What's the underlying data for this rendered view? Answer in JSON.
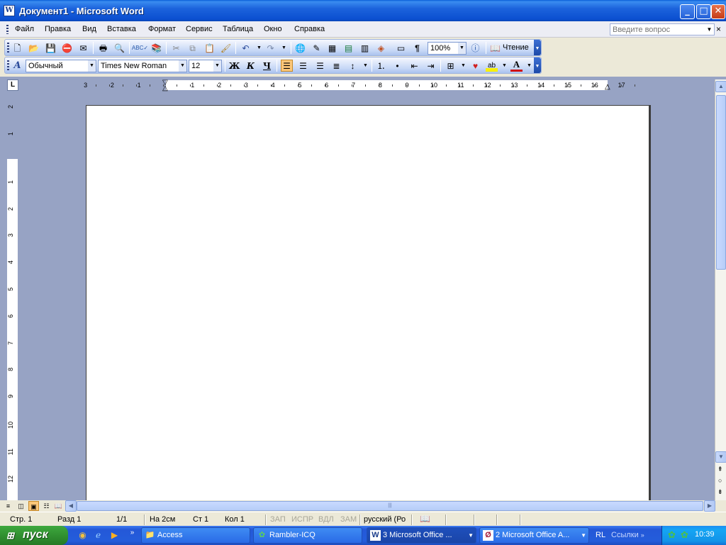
{
  "window": {
    "title": "Документ1 - Microsoft Word",
    "app_icon": "W",
    "controls": {
      "minimize": "_",
      "maximize": "□",
      "close": "✕"
    }
  },
  "menu": {
    "items": [
      "Файл",
      "Правка",
      "Вид",
      "Вставка",
      "Формат",
      "Сервис",
      "Таблица",
      "Окно",
      "Справка"
    ],
    "help_placeholder": "Введите вопрос",
    "doc_close": "×"
  },
  "toolbar_standard": {
    "icons": [
      "new-icon",
      "open-icon",
      "save-icon",
      "permission-icon",
      "email-icon",
      "print-icon",
      "print-preview-icon",
      "spelling-icon",
      "research-icon",
      "cut-icon",
      "copy-icon",
      "paste-icon",
      "format-painter-icon",
      "undo-icon",
      "redo-icon",
      "hyperlink-icon",
      "tables-borders-icon",
      "insert-table-icon",
      "insert-excel-icon",
      "columns-icon",
      "drawing-icon",
      "document-map-icon",
      "show-formatting-icon",
      "help-icon",
      "reading-icon"
    ],
    "zoom": "100%",
    "reading_label": "Чтение",
    "pilcrow": "¶"
  },
  "toolbar_formatting": {
    "style": "Обычный",
    "font": "Times New Roman",
    "size": "12",
    "bold": "Ж",
    "italic": "К",
    "underline": "Ч",
    "icons": [
      "styles-icon",
      "align-left-icon",
      "align-center-icon",
      "align-right-icon",
      "justify-icon",
      "line-spacing-icon",
      "numbering-icon",
      "bullets-icon",
      "decrease-indent-icon",
      "increase-indent-icon",
      "borders-icon",
      "heart-icon",
      "highlight-icon",
      "font-color-icon"
    ],
    "font_color_glyph": "A",
    "highlight_glyph": "ab"
  },
  "ruler": {
    "tab_selector": "L",
    "h_left_numbers": [
      "3",
      "2",
      "1"
    ],
    "h_right_numbers": [
      "1",
      "2",
      "3",
      "4",
      "5",
      "6",
      "7",
      "8",
      "9",
      "10",
      "11",
      "12",
      "13",
      "14",
      "15",
      "16",
      "17"
    ],
    "v_top_numbers": [
      "2",
      "1"
    ],
    "v_numbers": [
      "1",
      "2",
      "3",
      "4",
      "5",
      "6",
      "7",
      "8",
      "9",
      "10",
      "11",
      "12"
    ]
  },
  "status": {
    "page": "Стр. 1",
    "section": "Разд 1",
    "pages": "1/1",
    "at": "На 2см",
    "line": "Ст 1",
    "col": "Кол 1",
    "rec": "ЗАП",
    "trk": "ИСПР",
    "ext": "ВДЛ",
    "ovr": "ЗАМ",
    "language": "русский (Ро"
  },
  "taskbar": {
    "start_label": "пуск",
    "tasks": [
      {
        "label": "Access",
        "icon": "folder-icon",
        "pressed": false
      },
      {
        "label": "Rambler-ICQ",
        "icon": "icq-icon",
        "pressed": false
      },
      {
        "label": "3 Microsoft Office ...",
        "icon": "word-icon",
        "pressed": true
      },
      {
        "label": "2 Microsoft Office A...",
        "icon": "access-icon",
        "pressed": false
      }
    ],
    "lang": "RL",
    "links": "Ссылки",
    "clock": "10:39"
  },
  "colors": {
    "titlebar": "#0b4fd0",
    "workspace": "#97a3c4",
    "taskbar": "#245ddb",
    "start": "#2e8c2e"
  }
}
